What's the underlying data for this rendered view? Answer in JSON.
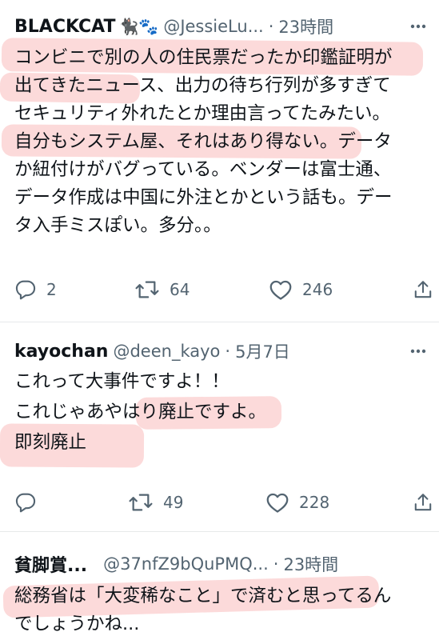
{
  "tweets": [
    {
      "name": "BLACKCAT",
      "emoji": "🐈‍⬛🐾",
      "handle": "@JessieLu...",
      "separator": "·",
      "time": "23時間",
      "lines": [
        "コンビニで別の人の住民票だったか印鑑証明が",
        "出てきたニュース、出力の待ち行列が多すぎて",
        "セキュリティ外れたとか理由言ってたみたい。",
        "自分もシステム屋、それはあり得ない。データ",
        "か紐付けがバグっている。ベンダーは富士通、",
        "データ作成は中国に外注とかという話も。デー",
        "タ入手ミスぽい。多分。。"
      ],
      "replies": "2",
      "retweets": "64",
      "likes": "246"
    },
    {
      "name": "kayochan",
      "handle": "@deen_kayo",
      "separator": "·",
      "time": "5月7日",
      "lines": [
        "これって大事件ですよ！！",
        "これじゃあやはり廃止ですよ。",
        "即刻廃止"
      ],
      "replies": "",
      "retweets": "49",
      "likes": "228"
    },
    {
      "name": "貧脚賞...",
      "handle": "@37nfZ9bQuPMQ...",
      "separator": "·",
      "time": "23時間",
      "lines": [
        "総務省は「大変稀なこと」で済むと思ってるん",
        "でしょうかね..."
      ]
    }
  ],
  "icons": {
    "reply": "reply-icon",
    "retweet": "retweet-icon",
    "like": "heart-icon",
    "share": "share-icon",
    "more": "more-icon"
  },
  "colors": {
    "text": "#0f1419",
    "secondary": "#536471",
    "highlight": "#f9adad",
    "divider": "#e7e9ea"
  }
}
